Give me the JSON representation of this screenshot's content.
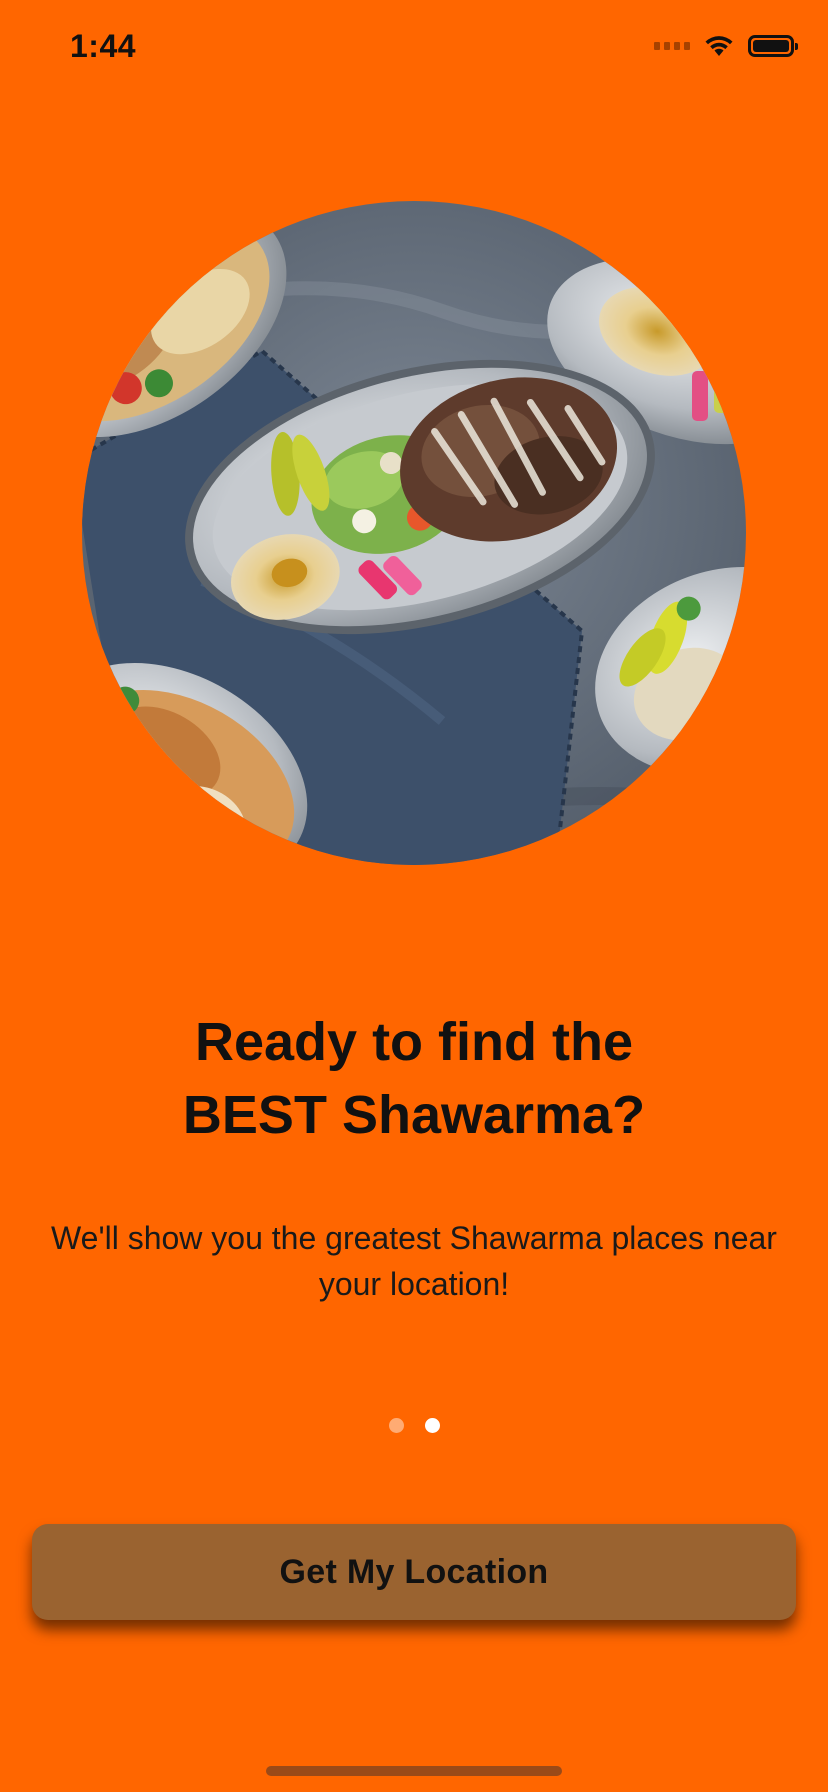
{
  "status_bar": {
    "time": "1:44",
    "icons": [
      "cellular-signal-icon",
      "wifi-icon",
      "battery-icon"
    ]
  },
  "hero": {
    "image": "shawarma-plates-photo"
  },
  "title": {
    "line1": "Ready to find the",
    "line2": "BEST Shawarma?"
  },
  "subtitle": "We'll show you the greatest Shawarma places near your location!",
  "pager": {
    "count": 2,
    "active_index": 1
  },
  "button": {
    "label": "Get My Location"
  },
  "colors": {
    "background": "#ff6600",
    "button": "#9a6330",
    "text": "#111111",
    "dot_active": "#ffffff",
    "dot_inactive": "#ffb380"
  }
}
